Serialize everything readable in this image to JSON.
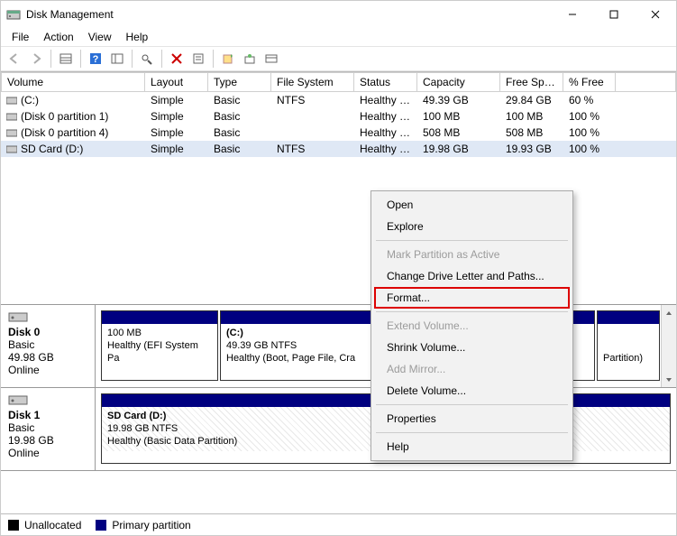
{
  "window": {
    "title": "Disk Management",
    "min_tip": "Minimize",
    "max_tip": "Maximize",
    "close_tip": "Close"
  },
  "menubar": {
    "file": "File",
    "action": "Action",
    "view": "View",
    "help": "Help"
  },
  "columns": {
    "c0": "Volume",
    "c1": "Layout",
    "c2": "Type",
    "c3": "File System",
    "c4": "Status",
    "c5": "Capacity",
    "c6": "Free Spa...",
    "c7": "% Free"
  },
  "volumes": [
    {
      "name": "(C:)",
      "layout": "Simple",
      "type": "Basic",
      "fs": "NTFS",
      "status": "Healthy (B...",
      "cap": "49.39 GB",
      "free": "29.84 GB",
      "pct": "60 %",
      "selected": false
    },
    {
      "name": "(Disk 0 partition 1)",
      "layout": "Simple",
      "type": "Basic",
      "fs": "",
      "status": "Healthy (E...",
      "cap": "100 MB",
      "free": "100 MB",
      "pct": "100 %",
      "selected": false
    },
    {
      "name": "(Disk 0 partition 4)",
      "layout": "Simple",
      "type": "Basic",
      "fs": "",
      "status": "Healthy (R...",
      "cap": "508 MB",
      "free": "508 MB",
      "pct": "100 %",
      "selected": false
    },
    {
      "name": "SD Card (D:)",
      "layout": "Simple",
      "type": "Basic",
      "fs": "NTFS",
      "status": "Healthy (B...",
      "cap": "19.98 GB",
      "free": "19.93 GB",
      "pct": "100 %",
      "selected": true
    }
  ],
  "disks": {
    "d0": {
      "title": "Disk 0",
      "kind": "Basic",
      "size": "49.98 GB",
      "state": "Online",
      "p1_size": "100 MB",
      "p1_status": "Healthy (EFI System Pa",
      "p2_name": "(C:)",
      "p2_size": "49.39 GB NTFS",
      "p2_status": "Healthy (Boot, Page File, Cra",
      "p3_name": "",
      "p3_size": "",
      "p3_status": "Partition)"
    },
    "d1": {
      "title": "Disk 1",
      "kind": "Basic",
      "size": "19.98 GB",
      "state": "Online",
      "p1_name": "SD Card  (D:)",
      "p1_size": "19.98 GB NTFS",
      "p1_status": "Healthy (Basic Data Partition)"
    }
  },
  "legend": {
    "un": "Unallocated",
    "pp": "Primary partition"
  },
  "context_menu": {
    "open": "Open",
    "explore": "Explore",
    "mark": "Mark Partition as Active",
    "change": "Change Drive Letter and Paths...",
    "format": "Format...",
    "extend": "Extend Volume...",
    "shrink": "Shrink Volume...",
    "mirror": "Add Mirror...",
    "delete": "Delete Volume...",
    "props": "Properties",
    "help": "Help"
  }
}
